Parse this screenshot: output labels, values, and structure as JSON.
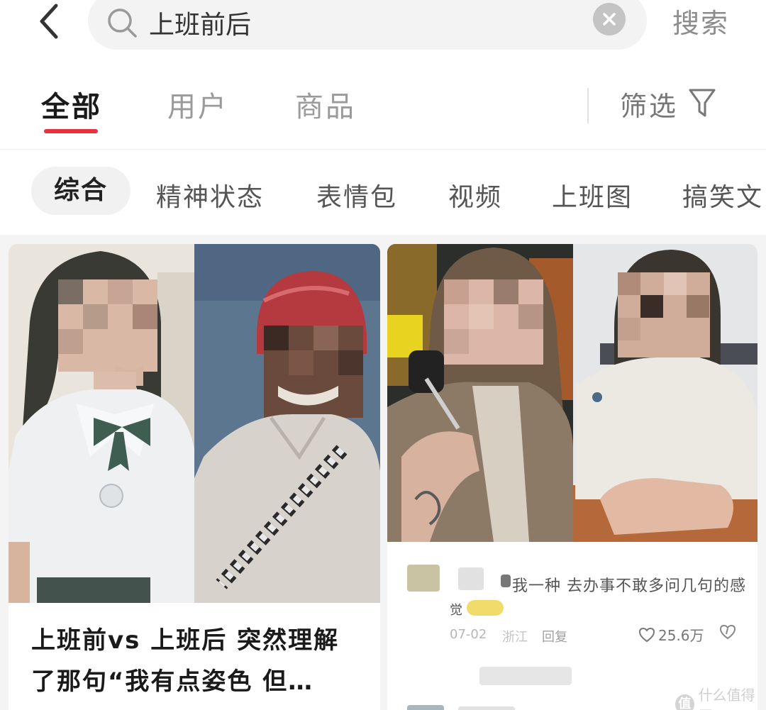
{
  "search": {
    "query": "上班前后",
    "submit_label": "搜索"
  },
  "tabs": [
    {
      "label": "全部",
      "active": true
    },
    {
      "label": "用户",
      "active": false
    },
    {
      "label": "商品",
      "active": false
    }
  ],
  "filter": {
    "label": "筛选"
  },
  "subcategories": [
    {
      "label": "综合",
      "active": true
    },
    {
      "label": "精神状态"
    },
    {
      "label": "表情包"
    },
    {
      "label": "视频"
    },
    {
      "label": "上班图"
    },
    {
      "label": "搞笑文"
    }
  ],
  "cards": [
    {
      "title_line1": "上班前vs 上班后 突然理解",
      "title_line2": "了那句“我有点姿色 但…"
    },
    {
      "comment_text": "我一种 去办事不敢多问几句的感",
      "comment_text_line2": "觉",
      "comment_date": "07-02",
      "comment_region": "浙江",
      "reply_label": "回复",
      "likes": "25.6万"
    }
  ],
  "watermark": {
    "text": "什么值得买",
    "logo_text": "值"
  },
  "colors": {
    "accent": "#e8303f",
    "tab_inactive": "#9a9a9a",
    "background": "#f4f4f4"
  }
}
